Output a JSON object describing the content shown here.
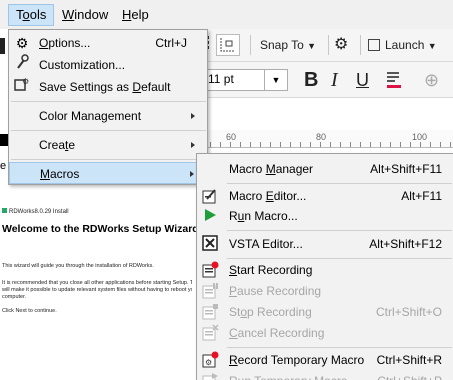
{
  "menubar": {
    "items": [
      {
        "label": "Tools",
        "mnemonic": "o"
      },
      {
        "label": "Window",
        "mnemonic": "W"
      },
      {
        "label": "Help",
        "mnemonic": "H"
      }
    ]
  },
  "background": {
    "toolbar": {
      "snap_to": "Snap To",
      "launch": "Launch"
    },
    "font_size": "11 pt",
    "ruler_labels": [
      "60",
      "80",
      "100"
    ],
    "left_fragment": "e",
    "installer": {
      "title_small": "RDWorks8.0.29 Install",
      "heading": "Welcome to the RDWorks Setup Wizard",
      "lines": [
        "This wizard will guide you through the installation of RDWorks.",
        "It is recommended that you close all other applications before starting Setup. This",
        "will make it possible to update relevant system files without having to reboot your",
        "computer.",
        "Click Next to continue."
      ]
    }
  },
  "tools_menu": {
    "items": [
      {
        "label": "Options...",
        "shortcut": "Ctrl+J",
        "icon": "gear-icon"
      },
      {
        "label": "Customization...",
        "icon": "wrench-icon"
      },
      {
        "label": "Save Settings as Default",
        "icon": "save-settings-icon"
      },
      {
        "label": "Color Management",
        "submenu": true
      },
      {
        "label": "Create",
        "submenu": true
      },
      {
        "label": "Macros",
        "submenu": true,
        "highlighted": true
      }
    ]
  },
  "macros_menu": {
    "items": [
      {
        "label": "Macro Manager",
        "shortcut": "Alt+Shift+F11",
        "enabled": true
      },
      {
        "label": "Macro Editor...",
        "shortcut": "Alt+F11",
        "enabled": true,
        "icon": "macro-editor-icon"
      },
      {
        "label": "Run Macro...",
        "shortcut": "",
        "enabled": true,
        "icon": "play-icon"
      },
      {
        "label": "VSTA Editor...",
        "shortcut": "Alt+Shift+F12",
        "enabled": true,
        "icon": "vsta-icon"
      },
      {
        "label": "Start Recording",
        "shortcut": "",
        "enabled": true,
        "icon": "record-icon"
      },
      {
        "label": "Pause Recording",
        "shortcut": "",
        "enabled": false,
        "icon": "pause-recording-icon"
      },
      {
        "label": "Stop Recording",
        "shortcut": "Ctrl+Shift+O",
        "enabled": false,
        "icon": "stop-recording-icon"
      },
      {
        "label": "Cancel Recording",
        "shortcut": "",
        "enabled": false,
        "icon": "cancel-recording-icon"
      },
      {
        "label": "Record Temporary Macro",
        "shortcut": "Ctrl+Shift+R",
        "enabled": true,
        "icon": "record-temporary-icon"
      },
      {
        "label": "Run Temporary Macro",
        "shortcut": "Ctrl+Shift+P",
        "enabled": false,
        "icon": "run-temporary-icon"
      }
    ]
  },
  "colors": {
    "highlight": "#cce4f7",
    "highlight_border": "#9fc6e8",
    "menu_bg": "#f2f2f2",
    "disabled_text": "#a6a6a6",
    "record_red": "#e81123",
    "play_green": "#1e9e3a"
  }
}
